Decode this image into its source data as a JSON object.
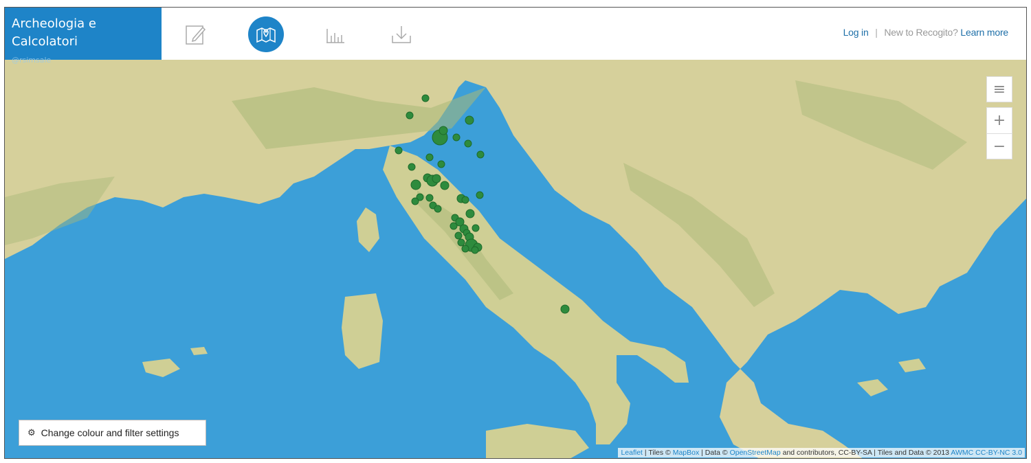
{
  "document": {
    "title_line1": "Archeologia e",
    "title_line2": "Calcolatori",
    "owner": "@rsimsale"
  },
  "toolbar": {
    "tabs": [
      {
        "name": "edit",
        "icon": "edit-icon",
        "active": false
      },
      {
        "name": "map",
        "icon": "map-icon",
        "active": true
      },
      {
        "name": "stats",
        "icon": "stats-icon",
        "active": false
      },
      {
        "name": "download",
        "icon": "download-icon",
        "active": false
      }
    ]
  },
  "account": {
    "login": "Log in",
    "separator": "|",
    "new_to": "New to Recogito?",
    "learn_more": "Learn more"
  },
  "map_controls": {
    "layers": "≡",
    "zoom_in": "+",
    "zoom_out": "−"
  },
  "filter_button": {
    "label": "Change colour and filter settings",
    "icon": "gear-icon"
  },
  "attribution": {
    "leaflet": "Leaflet",
    "tiles_prefix": "| Tiles ©",
    "mapbox": "MapBox",
    "data_prefix": "| Data ©",
    "osm": "OpenStreetMap",
    "mid": "and contributors, CC-BY-SA | Tiles and Data © 2013",
    "awmc": "AWMC CC-BY-NC 3.0"
  },
  "colors": {
    "accent": "#1e84c8",
    "sea": "#3c9fd8",
    "land": "#d9d4a4",
    "marker": "#2e8b3d"
  },
  "markers_count_visible": 60
}
